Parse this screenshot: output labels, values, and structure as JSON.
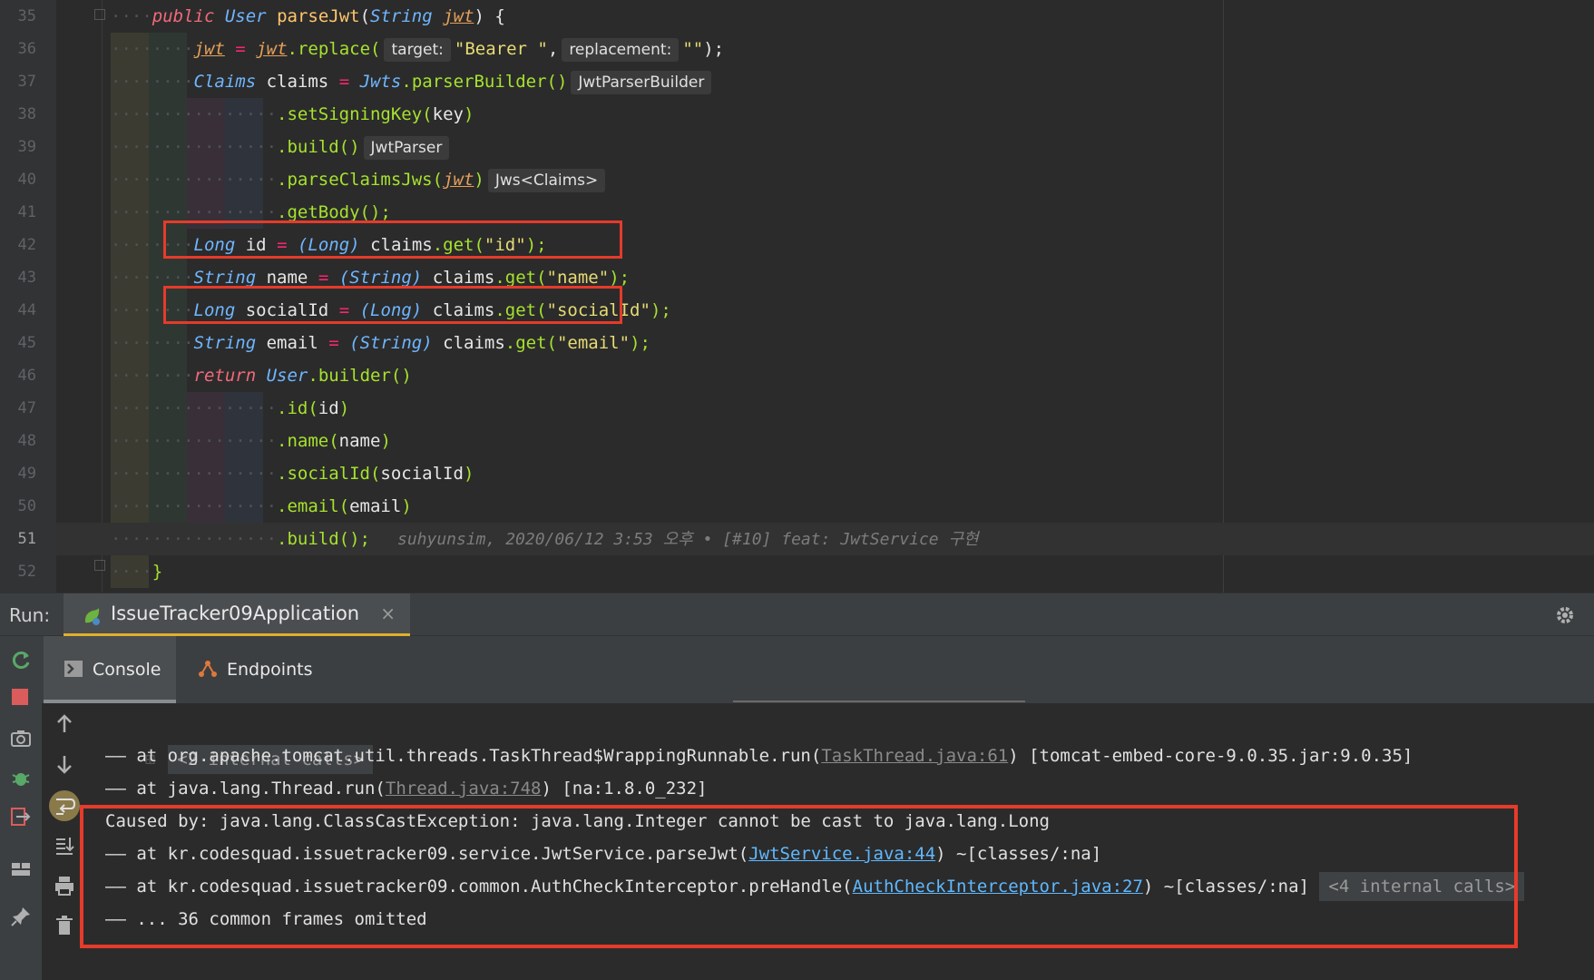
{
  "editor": {
    "line_numbers": [
      "35",
      "36",
      "37",
      "38",
      "39",
      "40",
      "41",
      "42",
      "43",
      "44",
      "45",
      "46",
      "47",
      "48",
      "49",
      "50",
      "51",
      "52"
    ],
    "lines": {
      "l35": {
        "kw": "public",
        "type": "User",
        "method": "parseJwt",
        "open": "(",
        "ptype": "String",
        "param": "jwt",
        "close": ") {"
      },
      "l36": {
        "var1": "jwt",
        "eq": "=",
        "var2": "jwt",
        "call": ".replace(",
        "hint1": "target:",
        "str1": "\"Bearer \"",
        "comma": ",",
        "hint2": "replacement:",
        "str2": "\"\"",
        "end": ");"
      },
      "l37": {
        "type": "Claims",
        "var": "claims",
        "eq": "=",
        "cls": "Jwts",
        "call": ".parserBuilder()",
        "hint": "JwtParserBuilder"
      },
      "l38": {
        "text": ".setSigningKey(",
        "arg": "key",
        "end": ")"
      },
      "l39": {
        "text": ".build()",
        "hint": "JwtParser"
      },
      "l40": {
        "text": ".parseClaimsJws(",
        "arg": "jwt",
        "end": ")",
        "hint": "Jws<Claims>"
      },
      "l41": {
        "text": ".getBody();"
      },
      "l42": {
        "type": "Long",
        "var": "id",
        "eq": "=",
        "cast": "(Long)",
        "obj": "claims",
        "call": ".get(",
        "str": "\"id\"",
        "end": ");"
      },
      "l43": {
        "type": "String",
        "var": "name",
        "eq": "=",
        "cast": "(String)",
        "obj": "claims",
        "call": ".get(",
        "str": "\"name\"",
        "end": ");"
      },
      "l44": {
        "type": "Long",
        "var": "socialId",
        "eq": "=",
        "cast": "(Long)",
        "obj": "claims",
        "call": ".get(",
        "str": "\"socialId\"",
        "end": ");"
      },
      "l45": {
        "type": "String",
        "var": "email",
        "eq": "=",
        "cast": "(String)",
        "obj": "claims",
        "call": ".get(",
        "str": "\"email\"",
        "end": ");"
      },
      "l46": {
        "kw": "return",
        "cls": "User",
        "call": ".builder()"
      },
      "l47": {
        "text": ".id(",
        "arg": "id",
        "end": ")"
      },
      "l48": {
        "text": ".name(",
        "arg": "name",
        "end": ")"
      },
      "l49": {
        "text": ".socialId(",
        "arg": "socialId",
        "end": ")"
      },
      "l50": {
        "text": ".email(",
        "arg": "email",
        "end": ")"
      },
      "l51": {
        "text": ".build();",
        "blame": "suhyunsim, 2020/06/12 3:53 오후 • [#10] feat: JwtService 구현"
      },
      "l52": {
        "text": "}"
      }
    }
  },
  "run_panel": {
    "label": "Run:",
    "tab_title": "IssueTracker09Application",
    "tab_close": "×",
    "console_tabs": [
      {
        "label": "Console"
      },
      {
        "label": "Endpoints"
      }
    ]
  },
  "console": {
    "internal_calls_1": "<2 internal calls>",
    "line1": {
      "dash": "——",
      "text": " at org.apache.tomcat.util.threads.TaskThread$WrappingRunnable.run(",
      "link": "TaskThread.java:61",
      "suffix": ") [tomcat-embed-core-9.0.35.jar:9.0.35]"
    },
    "line2": {
      "dash": "——",
      "text": " at java.lang.Thread.run(",
      "link": "Thread.java:748",
      "suffix": ") [na:1.8.0_232]"
    },
    "line3": {
      "text": "Caused by: java.lang.ClassCastException: java.lang.Integer cannot be cast to java.lang.Long"
    },
    "line4": {
      "dash": "——",
      "text": " at kr.codesquad.issuetracker09.service.JwtService.parseJwt(",
      "link": "JwtService.java:44",
      "suffix": ") ~[classes/:na]"
    },
    "line5": {
      "dash": "——",
      "text": " at kr.codesquad.issuetracker09.common.AuthCheckInterceptor.preHandle(",
      "link": "AuthCheckInterceptor.java:27",
      "suffix": ") ~[classes/:na]",
      "pill": "<4 internal calls>"
    },
    "line6": {
      "dash": "——",
      "text": " ... 36 common frames omitted"
    }
  },
  "colors": {
    "highlight_box": "#e53b2a",
    "active_tab_underline": "#e0b02c",
    "link": "#5fb8ff"
  }
}
